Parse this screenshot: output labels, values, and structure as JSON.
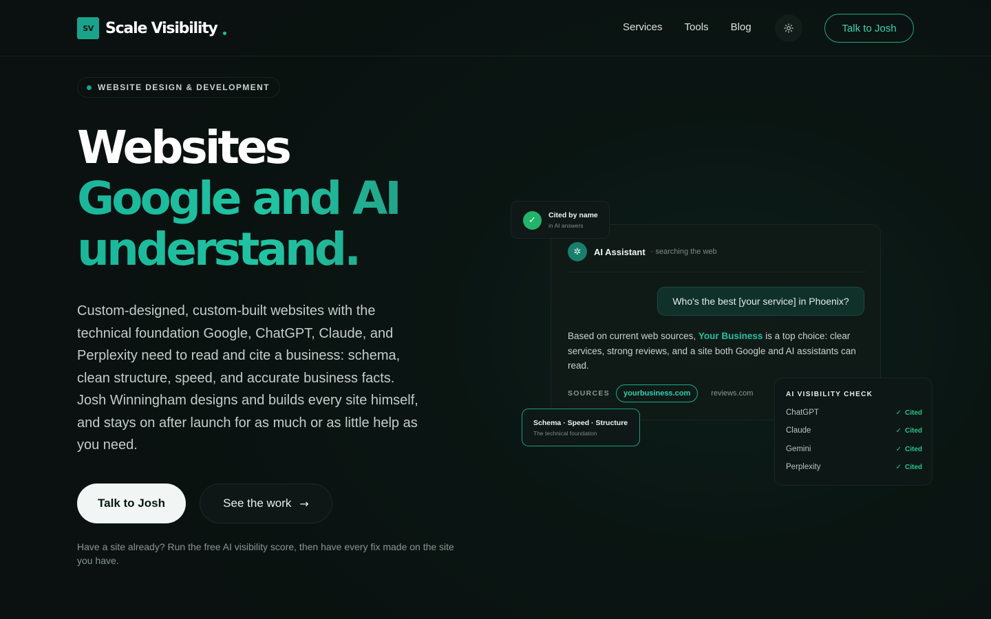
{
  "brand": {
    "mark": "SV",
    "name": "Scale Visibility"
  },
  "nav": {
    "links": [
      "Services",
      "Tools",
      "Blog"
    ],
    "theme_icon": "sun-icon",
    "cta": "Talk to Josh"
  },
  "hero": {
    "eyebrow": "WEBSITE DESIGN & DEVELOPMENT",
    "heading": {
      "line1": "Websites",
      "line2": "Google and AI",
      "line3": "understand."
    },
    "lede": "Custom-designed, custom-built websites with the technical foundation Google, ChatGPT, Claude, and Perplexity need to read and cite a business: schema, clean structure, speed, and accurate business facts. Josh Winningham designs and builds every site himself, and stays on after launch for as much or as little help as you need.",
    "primary_cta": "Talk to Josh",
    "secondary_cta": "See the work",
    "secondary_icon": "arrow-right-icon",
    "note": "Have a site already? Run the free AI visibility score, then have every fix made on the site you have."
  },
  "illustration": {
    "cited_badge": {
      "title": "Cited by name",
      "subtitle": "in AI answers",
      "icon": "check-icon"
    },
    "assistant": {
      "name": "AI Assistant",
      "status": "· searching the web",
      "question": "Who's the best [your service] in Phoenix?",
      "answer_before": "Based on current web sources, ",
      "answer_highlight": "Your Business",
      "answer_after": " is a top choice: clear services, strong reviews, and a site both Google and AI assistants can read.",
      "sources_label": "SOURCES",
      "sources": [
        "yourbusiness.com",
        "reviews.com"
      ]
    },
    "schema_badge": {
      "title": "Schema · Speed · Structure",
      "subtitle": "The technical foundation"
    },
    "visibility_check": {
      "title": "AI VISIBILITY CHECK",
      "rows": [
        {
          "engine": "ChatGPT",
          "status": "Cited"
        },
        {
          "engine": "Claude",
          "status": "Cited"
        },
        {
          "engine": "Gemini",
          "status": "Cited"
        },
        {
          "engine": "Perplexity",
          "status": "Cited"
        }
      ]
    }
  },
  "colors": {
    "accent": "#1fb89a",
    "background": "#0a1311",
    "success": "#29c48a"
  }
}
